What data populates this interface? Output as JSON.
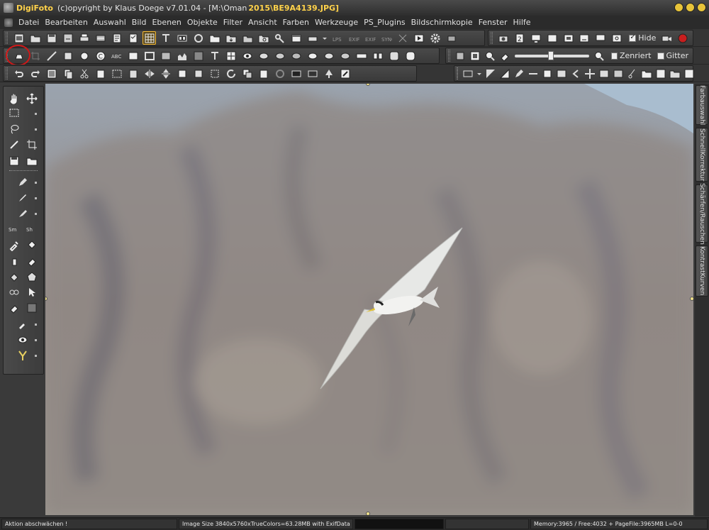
{
  "titlebar": {
    "app_name": "DigiFoto",
    "text": "(c)opyright by Klaus Doege v7.01.04 - [M:\\Oman",
    "file": "2015\\BE9A4139.JPG]"
  },
  "menu": {
    "items": [
      "Datei",
      "Bearbeiten",
      "Auswahl",
      "Bild",
      "Ebenen",
      "Objekte",
      "Filter",
      "Ansicht",
      "Farben",
      "Werkzeuge",
      "PS_Plugins",
      "Bildschirmkopie",
      "Fenster",
      "Hilfe"
    ]
  },
  "toolbar1": {
    "hide_label": "Hide",
    "hide_checked": true
  },
  "toolbar2": {
    "zoom_level": 0.48,
    "zentriert_label": "Zenriert",
    "zentriert_checked": false,
    "gitter_label": "Gitter",
    "gitter_checked": false
  },
  "side_tabs": [
    "Farbauswahl",
    "SchnellKorrektur",
    "Schärfen/Rauschen",
    "KontrastKurven"
  ],
  "status": {
    "hint": "Aktion abschwächen !",
    "image_info": "Image Size 3840x5760xTrueColors=63.28MB  with ExifData",
    "memory": "Memory:3965 / Free:4032 + PageFile:3965MB L=0-0"
  },
  "colors": {
    "accent": "#ffd24a",
    "highlight_ring": "#d01818",
    "record_button": "#c81e1e"
  }
}
